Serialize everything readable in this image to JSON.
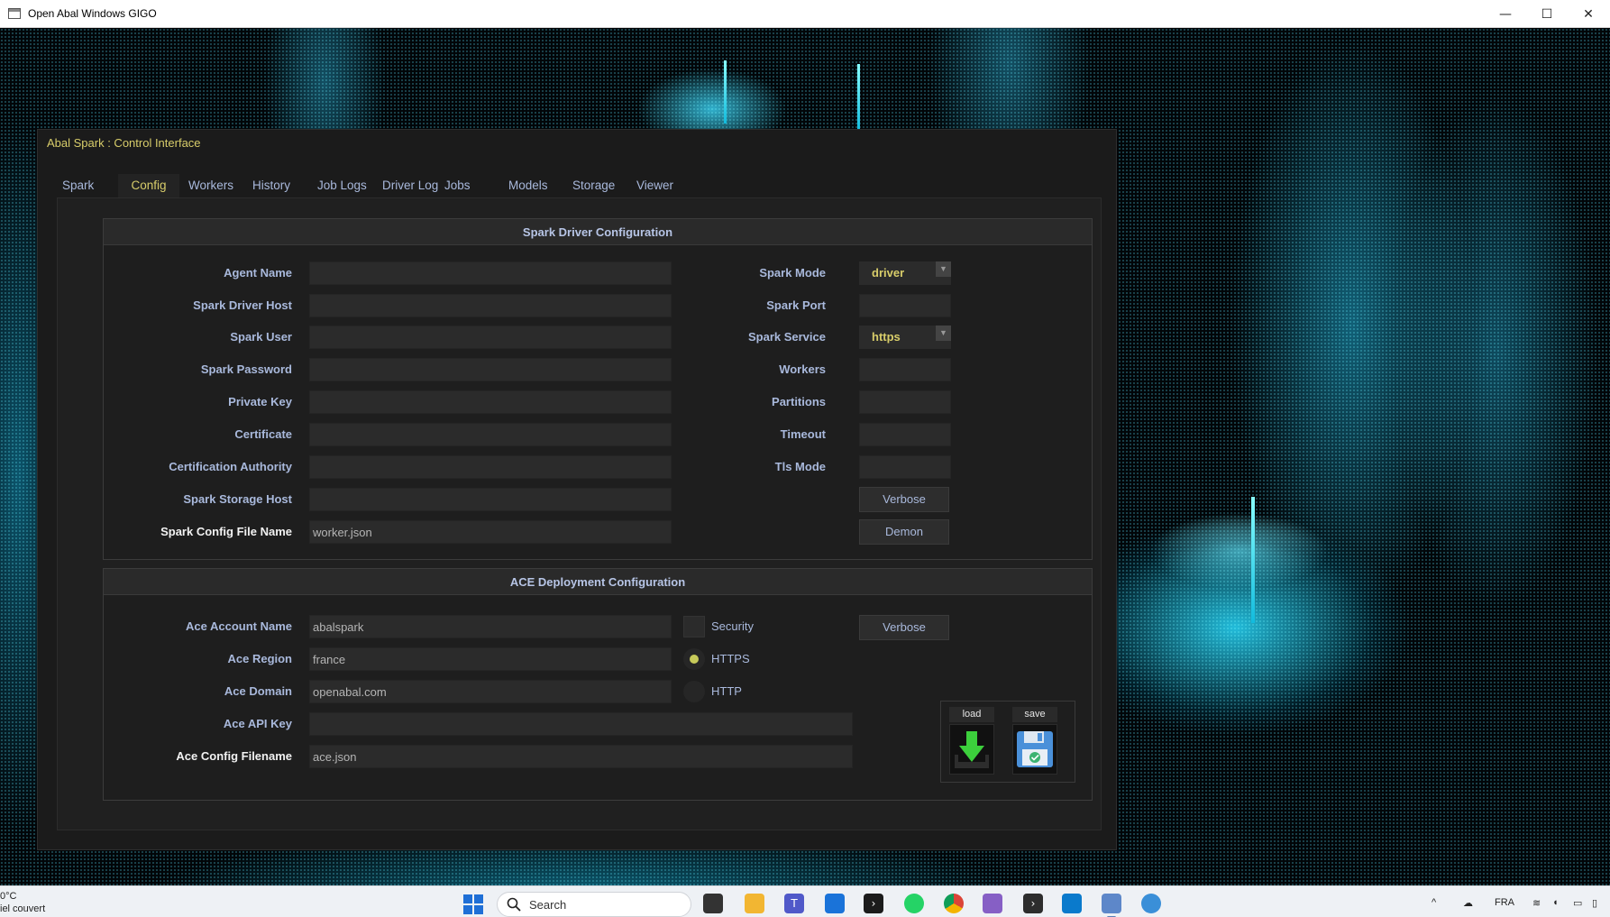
{
  "window": {
    "title": "Open Abal Windows GIGO",
    "minimize_glyph": "—",
    "maximize_glyph": "☐",
    "close_glyph": "✕"
  },
  "panel": {
    "title": "Abal Spark : Control Interface"
  },
  "tabs": [
    {
      "label": "Spark",
      "active": false
    },
    {
      "label": "Config",
      "active": true
    },
    {
      "label": "Workers",
      "active": false
    },
    {
      "label": "History",
      "active": false
    },
    {
      "label": "Job Logs",
      "active": false
    },
    {
      "label": "Driver Log",
      "active": false
    },
    {
      "label": "Jobs",
      "active": false
    },
    {
      "label": "Models",
      "active": false
    },
    {
      "label": "Storage",
      "active": false
    },
    {
      "label": "Viewer",
      "active": false
    }
  ],
  "driver_config": {
    "header": "Spark Driver Configuration",
    "agent_name": {
      "label": "Agent Name",
      "value": ""
    },
    "driver_host": {
      "label": "Spark Driver Host",
      "value": ""
    },
    "user": {
      "label": "Spark User",
      "value": ""
    },
    "password": {
      "label": "Spark Password",
      "value": ""
    },
    "private_key": {
      "label": "Private Key",
      "value": ""
    },
    "certificate": {
      "label": "Certificate",
      "value": ""
    },
    "cert_authority": {
      "label": "Certification Authority",
      "value": ""
    },
    "storage_host": {
      "label": "Spark Storage Host",
      "value": ""
    },
    "config_file": {
      "label": "Spark Config File Name",
      "value": "worker.json"
    },
    "mode": {
      "label": "Spark Mode",
      "value": "driver"
    },
    "port": {
      "label": "Spark Port",
      "value": ""
    },
    "service": {
      "label": "Spark Service",
      "value": "https"
    },
    "workers": {
      "label": "Workers",
      "value": ""
    },
    "partitions": {
      "label": "Partitions",
      "value": ""
    },
    "timeout": {
      "label": "Timeout",
      "value": ""
    },
    "tls_mode": {
      "label": "Tls Mode",
      "value": ""
    },
    "verbose_button": "Verbose",
    "demon_button": "Demon"
  },
  "ace_config": {
    "header": "ACE Deployment Configuration",
    "account_name": {
      "label": "Ace Account Name",
      "value": "abalspark"
    },
    "region": {
      "label": "Ace Region",
      "value": "france"
    },
    "domain": {
      "label": "Ace Domain",
      "value": "openabal.com"
    },
    "api_key": {
      "label": "Ace API Key",
      "value": ""
    },
    "config_filename": {
      "label": "Ace Config Filename",
      "value": "ace.json"
    },
    "security_label": "Security",
    "https_label": "HTTPS",
    "http_label": "HTTP",
    "protocol_selected": "HTTPS",
    "verbose_button": "Verbose",
    "load_label": "load",
    "save_label": "save"
  },
  "taskbar": {
    "weather_temp": "0°C",
    "weather_desc": "iel couvert",
    "search_placeholder": "Search",
    "language": "FRA"
  },
  "colors": {
    "accent_yellow": "#d8cd6a",
    "label_blue": "#a9b9dc",
    "panel_bg": "#1b1b1b",
    "field_bg": "#2b2b2b",
    "desktop_cyan": "#28dcff"
  }
}
